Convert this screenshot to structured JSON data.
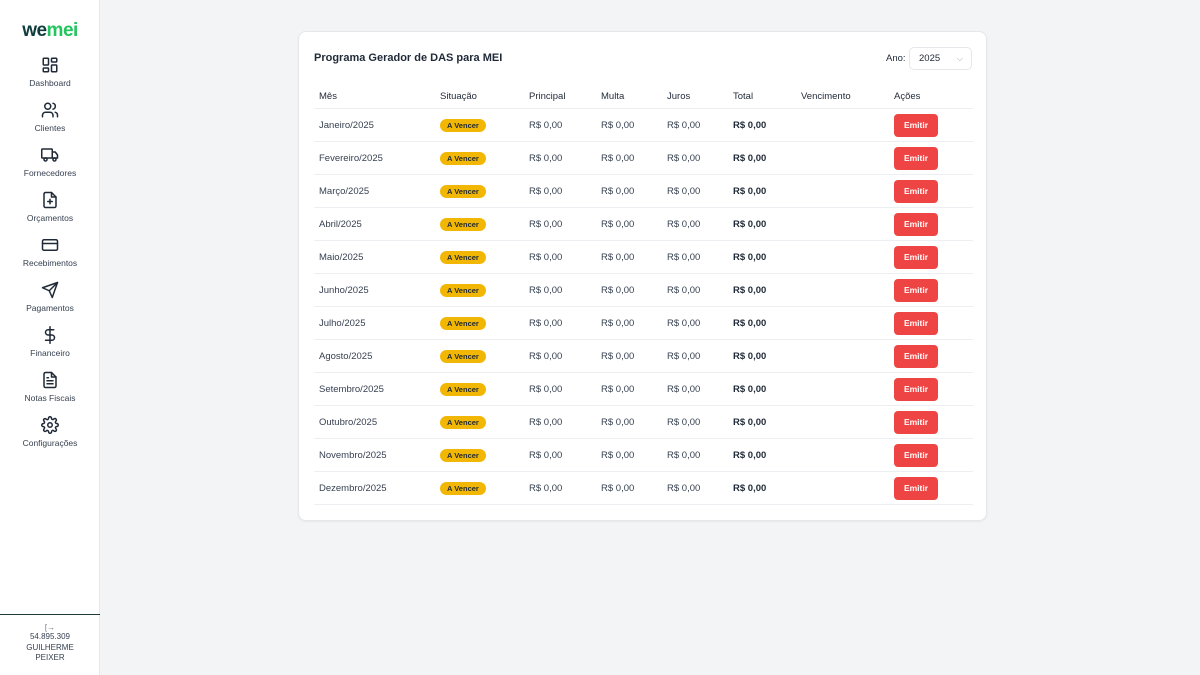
{
  "brand": {
    "part1": "we",
    "part2": "mei"
  },
  "nav": [
    {
      "label": "Dashboard",
      "icon": "dashboard-icon"
    },
    {
      "label": "Clientes",
      "icon": "users-icon"
    },
    {
      "label": "Fornecedores",
      "icon": "truck-icon"
    },
    {
      "label": "Orçamentos",
      "icon": "file-plus-icon"
    },
    {
      "label": "Recebimentos",
      "icon": "credit-card-icon"
    },
    {
      "label": "Pagamentos",
      "icon": "send-icon"
    },
    {
      "label": "Financeiro",
      "icon": "dollar-icon"
    },
    {
      "label": "Notas Fiscais",
      "icon": "file-text-icon"
    },
    {
      "label": "Configurações",
      "icon": "gear-icon"
    }
  ],
  "footer": {
    "logout_icon": "[→",
    "cnpj": "54.895.309",
    "name_line1": "GUILHERME",
    "name_line2": "PEIXER"
  },
  "card": {
    "title": "Programa Gerador de DAS para MEI",
    "year_label": "Ano:",
    "year_value": "2025"
  },
  "table": {
    "headers": {
      "mes": "Mês",
      "situacao": "Situação",
      "principal": "Principal",
      "multa": "Multa",
      "juros": "Juros",
      "total": "Total",
      "vencimento": "Vencimento",
      "acoes": "Ações"
    },
    "rows": [
      {
        "mes": "Janeiro/2025",
        "situacao": "A Vencer",
        "principal": "R$ 0,00",
        "multa": "R$ 0,00",
        "juros": "R$ 0,00",
        "total": "R$ 0,00",
        "vencimento": "",
        "acao": "Emitir"
      },
      {
        "mes": "Fevereiro/2025",
        "situacao": "A Vencer",
        "principal": "R$ 0,00",
        "multa": "R$ 0,00",
        "juros": "R$ 0,00",
        "total": "R$ 0,00",
        "vencimento": "",
        "acao": "Emitir"
      },
      {
        "mes": "Março/2025",
        "situacao": "A Vencer",
        "principal": "R$ 0,00",
        "multa": "R$ 0,00",
        "juros": "R$ 0,00",
        "total": "R$ 0,00",
        "vencimento": "",
        "acao": "Emitir"
      },
      {
        "mes": "Abril/2025",
        "situacao": "A Vencer",
        "principal": "R$ 0,00",
        "multa": "R$ 0,00",
        "juros": "R$ 0,00",
        "total": "R$ 0,00",
        "vencimento": "",
        "acao": "Emitir"
      },
      {
        "mes": "Maio/2025",
        "situacao": "A Vencer",
        "principal": "R$ 0,00",
        "multa": "R$ 0,00",
        "juros": "R$ 0,00",
        "total": "R$ 0,00",
        "vencimento": "",
        "acao": "Emitir"
      },
      {
        "mes": "Junho/2025",
        "situacao": "A Vencer",
        "principal": "R$ 0,00",
        "multa": "R$ 0,00",
        "juros": "R$ 0,00",
        "total": "R$ 0,00",
        "vencimento": "",
        "acao": "Emitir"
      },
      {
        "mes": "Julho/2025",
        "situacao": "A Vencer",
        "principal": "R$ 0,00",
        "multa": "R$ 0,00",
        "juros": "R$ 0,00",
        "total": "R$ 0,00",
        "vencimento": "",
        "acao": "Emitir"
      },
      {
        "mes": "Agosto/2025",
        "situacao": "A Vencer",
        "principal": "R$ 0,00",
        "multa": "R$ 0,00",
        "juros": "R$ 0,00",
        "total": "R$ 0,00",
        "vencimento": "",
        "acao": "Emitir"
      },
      {
        "mes": "Setembro/2025",
        "situacao": "A Vencer",
        "principal": "R$ 0,00",
        "multa": "R$ 0,00",
        "juros": "R$ 0,00",
        "total": "R$ 0,00",
        "vencimento": "",
        "acao": "Emitir"
      },
      {
        "mes": "Outubro/2025",
        "situacao": "A Vencer",
        "principal": "R$ 0,00",
        "multa": "R$ 0,00",
        "juros": "R$ 0,00",
        "total": "R$ 0,00",
        "vencimento": "",
        "acao": "Emitir"
      },
      {
        "mes": "Novembro/2025",
        "situacao": "A Vencer",
        "principal": "R$ 0,00",
        "multa": "R$ 0,00",
        "juros": "R$ 0,00",
        "total": "R$ 0,00",
        "vencimento": "",
        "acao": "Emitir"
      },
      {
        "mes": "Dezembro/2025",
        "situacao": "A Vencer",
        "principal": "R$ 0,00",
        "multa": "R$ 0,00",
        "juros": "R$ 0,00",
        "total": "R$ 0,00",
        "vencimento": "",
        "acao": "Emitir"
      }
    ]
  },
  "colors": {
    "accent_green": "#22c55e",
    "brand_dark": "#0f3d3e",
    "badge_yellow": "#f2b705",
    "button_red": "#ef4444"
  }
}
